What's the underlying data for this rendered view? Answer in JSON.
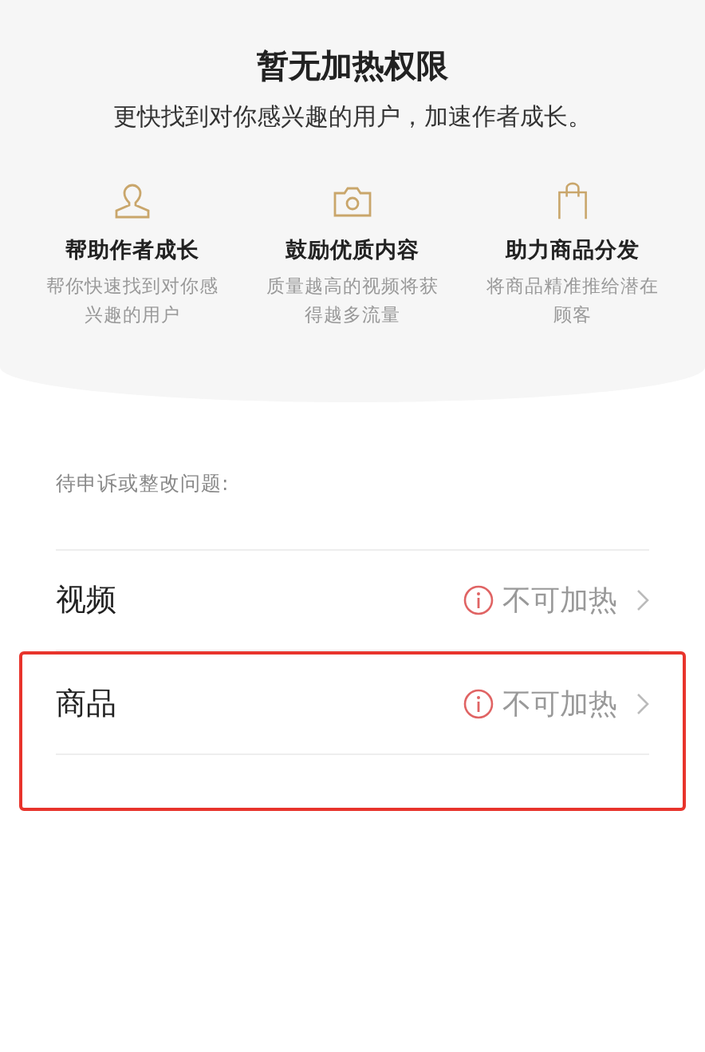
{
  "header": {
    "title": "暂无加热权限",
    "subtitle": "更快找到对你感兴趣的用户，加速作者成长。"
  },
  "benefits": [
    {
      "kind": "person",
      "title": "帮助作者成长",
      "desc": "帮你快速找到对你感兴趣的用户"
    },
    {
      "kind": "camera",
      "title": "鼓励优质内容",
      "desc": "质量越高的视频将获得越多流量"
    },
    {
      "kind": "bag",
      "title": "助力商品分发",
      "desc": "将商品精准推给潜在顾客"
    }
  ],
  "section_label": "待申诉或整改问题:",
  "issues": [
    {
      "name": "视频",
      "status": "不可加热",
      "highlighted": false
    },
    {
      "name": "商品",
      "status": "不可加热",
      "highlighted": true
    }
  ]
}
